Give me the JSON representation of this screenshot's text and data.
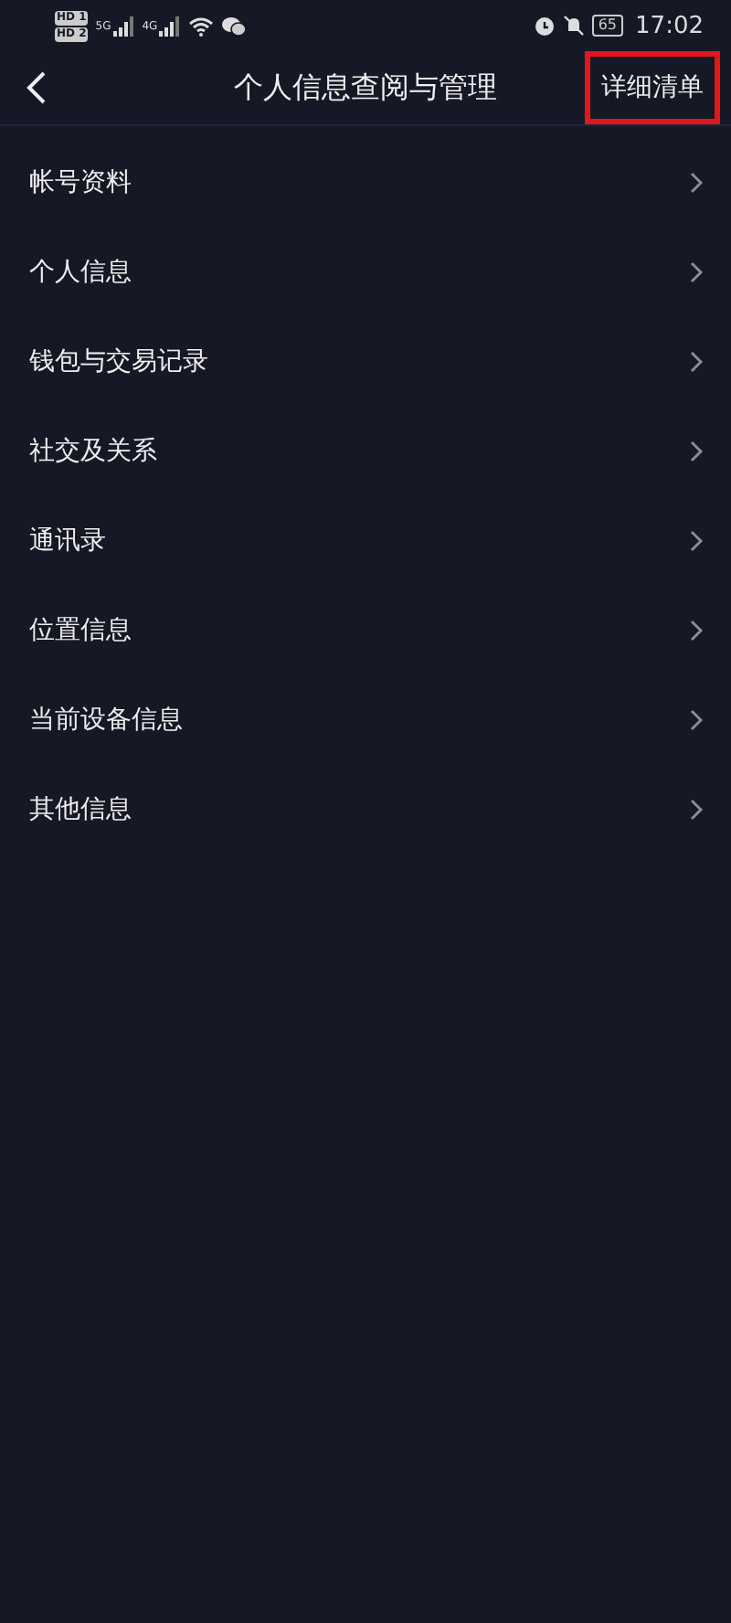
{
  "status_bar": {
    "sim_badges": [
      "HD 1",
      "HD 2"
    ],
    "networks": [
      "5G",
      "4G"
    ],
    "battery": "65",
    "time": "17:02"
  },
  "header": {
    "title": "个人信息查阅与管理",
    "action": "详细清单",
    "action_highlighted": true
  },
  "menu_items": [
    {
      "label": "帐号资料"
    },
    {
      "label": "个人信息"
    },
    {
      "label": "钱包与交易记录"
    },
    {
      "label": "社交及关系"
    },
    {
      "label": "通讯录"
    },
    {
      "label": "位置信息"
    },
    {
      "label": "当前设备信息"
    },
    {
      "label": "其他信息"
    }
  ]
}
